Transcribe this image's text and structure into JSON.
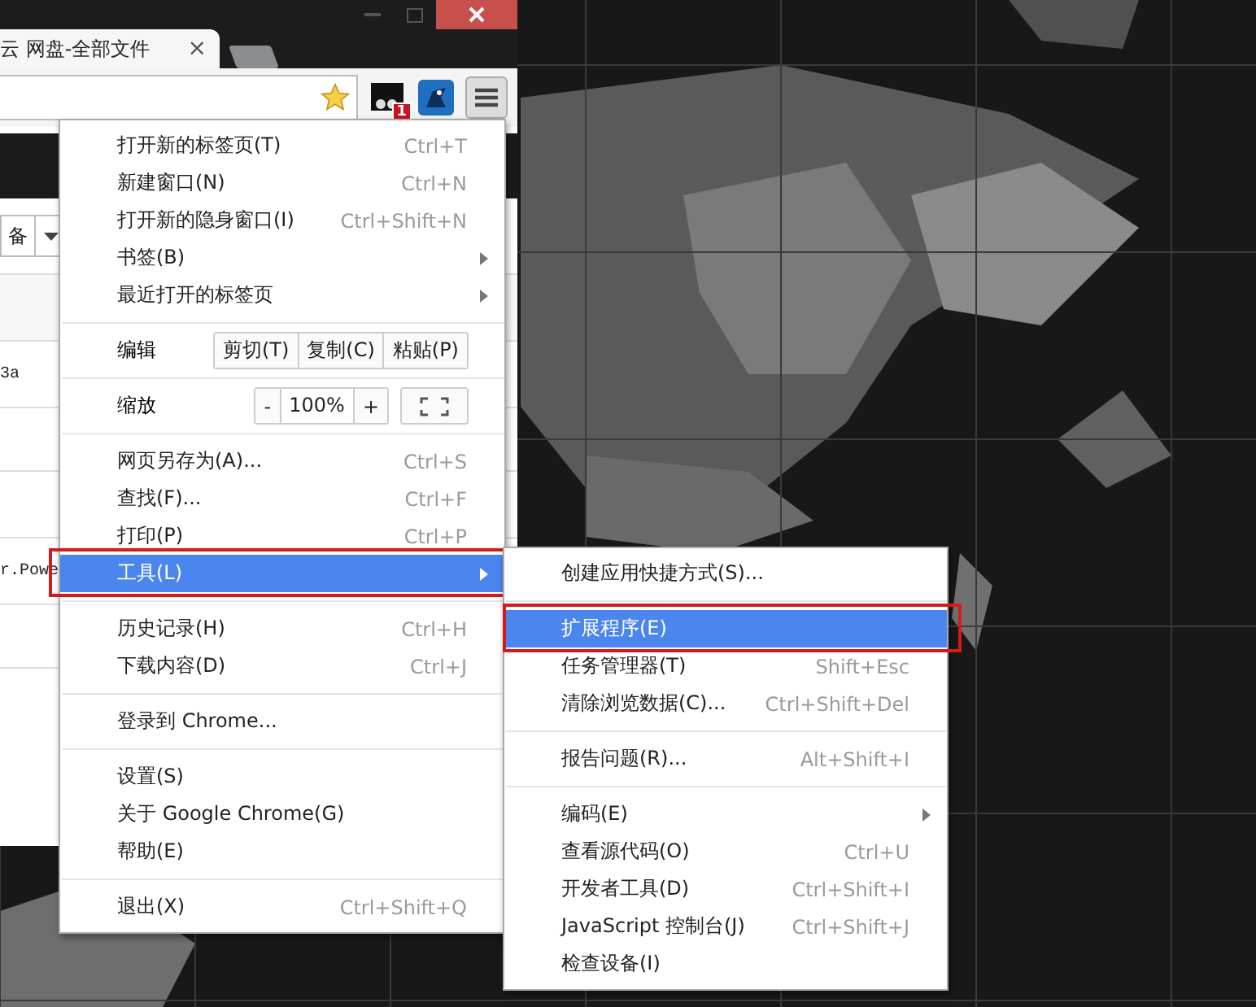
{
  "browser": {
    "tab_title": "云 网盘-全部文件",
    "tab_close": "×",
    "extension_badge": "1",
    "page_texts": [
      "备",
      "3a",
      "r.Powe"
    ]
  },
  "menu": {
    "items": [
      {
        "kind": "item",
        "label": "打开新的标签页(T)",
        "shortcut": "Ctrl+T",
        "has_submenu": false,
        "selected": false,
        "annotated": false
      },
      {
        "kind": "item",
        "label": "新建窗口(N)",
        "shortcut": "Ctrl+N",
        "has_submenu": false,
        "selected": false,
        "annotated": false
      },
      {
        "kind": "item",
        "label": "打开新的隐身窗口(I)",
        "shortcut": "Ctrl+Shift+N",
        "has_submenu": false,
        "selected": false,
        "annotated": false
      },
      {
        "kind": "item",
        "label": "书签(B)",
        "has_submenu": true,
        "selected": false,
        "annotated": false
      },
      {
        "kind": "item",
        "label": "最近打开的标签页",
        "has_submenu": true,
        "selected": false,
        "annotated": false
      },
      {
        "kind": "separator"
      },
      {
        "kind": "edit",
        "label": "编辑",
        "buttons": [
          "剪切(T)",
          "复制(C)",
          "粘贴(P)"
        ]
      },
      {
        "kind": "separator"
      },
      {
        "kind": "zoom",
        "label": "缩放",
        "minus": "-",
        "value": "100%",
        "plus": "+"
      },
      {
        "kind": "separator"
      },
      {
        "kind": "item",
        "label": "网页另存为(A)...",
        "shortcut": "Ctrl+S",
        "has_submenu": false,
        "selected": false,
        "annotated": false
      },
      {
        "kind": "item",
        "label": "查找(F)...",
        "shortcut": "Ctrl+F",
        "has_submenu": false,
        "selected": false,
        "annotated": false
      },
      {
        "kind": "item",
        "label": "打印(P)",
        "shortcut": "Ctrl+P",
        "has_submenu": false,
        "selected": false,
        "annotated": false
      },
      {
        "kind": "item",
        "label": "工具(L)",
        "has_submenu": true,
        "selected": true,
        "annotated": true
      },
      {
        "kind": "separator"
      },
      {
        "kind": "item",
        "label": "历史记录(H)",
        "shortcut": "Ctrl+H",
        "has_submenu": false,
        "selected": false,
        "annotated": false
      },
      {
        "kind": "item",
        "label": "下载内容(D)",
        "shortcut": "Ctrl+J",
        "has_submenu": false,
        "selected": false,
        "annotated": false
      },
      {
        "kind": "separator"
      },
      {
        "kind": "item",
        "label": "登录到 Chrome...",
        "has_submenu": false,
        "selected": false,
        "annotated": false
      },
      {
        "kind": "separator"
      },
      {
        "kind": "item",
        "label": "设置(S)",
        "has_submenu": false,
        "selected": false,
        "annotated": false
      },
      {
        "kind": "item",
        "label": "关于 Google Chrome(G)",
        "has_submenu": false,
        "selected": false,
        "annotated": false
      },
      {
        "kind": "item",
        "label": "帮助(E)",
        "has_submenu": false,
        "selected": false,
        "annotated": false
      },
      {
        "kind": "separator"
      },
      {
        "kind": "item",
        "label": "退出(X)",
        "shortcut": "Ctrl+Shift+Q",
        "has_submenu": false,
        "selected": false,
        "annotated": false
      }
    ]
  },
  "submenu": {
    "items": [
      {
        "kind": "item",
        "label": "创建应用快捷方式(S)...",
        "has_submenu": false,
        "selected": false,
        "annotated": false
      },
      {
        "kind": "separator"
      },
      {
        "kind": "item",
        "label": "扩展程序(E)",
        "has_submenu": false,
        "selected": true,
        "annotated": true
      },
      {
        "kind": "item",
        "label": "任务管理器(T)",
        "shortcut": "Shift+Esc",
        "has_submenu": false,
        "selected": false,
        "annotated": false
      },
      {
        "kind": "item",
        "label": "清除浏览数据(C)...",
        "shortcut": "Ctrl+Shift+Del",
        "has_submenu": false,
        "selected": false,
        "annotated": false
      },
      {
        "kind": "separator"
      },
      {
        "kind": "item",
        "label": "报告问题(R)...",
        "shortcut": "Alt+Shift+I",
        "has_submenu": false,
        "selected": false,
        "annotated": false
      },
      {
        "kind": "separator"
      },
      {
        "kind": "item",
        "label": "编码(E)",
        "has_submenu": true,
        "selected": false,
        "annotated": false
      },
      {
        "kind": "item",
        "label": "查看源代码(O)",
        "shortcut": "Ctrl+U",
        "has_submenu": false,
        "selected": false,
        "annotated": false
      },
      {
        "kind": "item",
        "label": "开发者工具(D)",
        "shortcut": "Ctrl+Shift+I",
        "has_submenu": false,
        "selected": false,
        "annotated": false
      },
      {
        "kind": "item",
        "label": "JavaScript 控制台(J)",
        "shortcut": "Ctrl+Shift+J",
        "has_submenu": false,
        "selected": false,
        "annotated": false
      },
      {
        "kind": "item",
        "label": "检查设备(I)",
        "has_submenu": false,
        "selected": false,
        "annotated": false
      }
    ]
  }
}
